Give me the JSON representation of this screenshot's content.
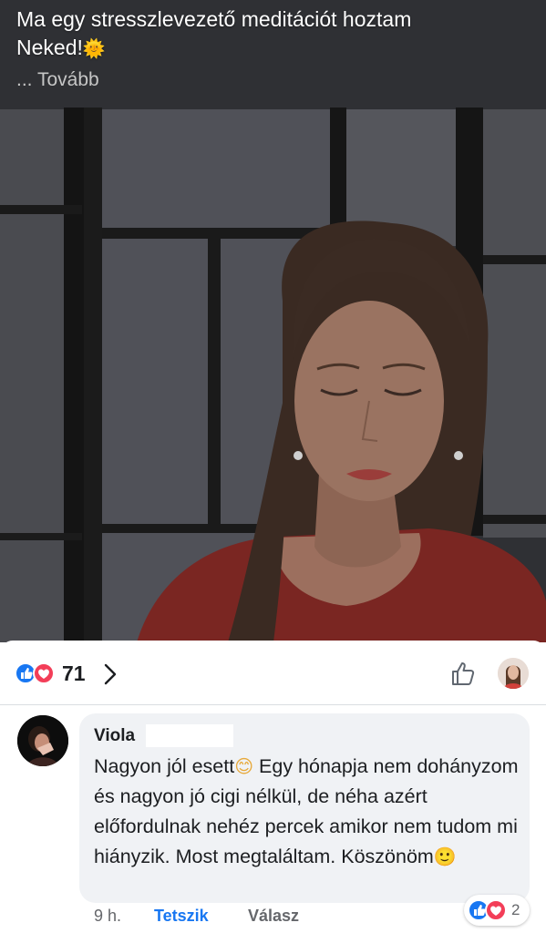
{
  "post": {
    "caption_line1": "Ma egy stresszlevezető meditációt hoztam",
    "caption_line2": "Neked!",
    "caption_emoji": "🌞",
    "more_label": "... Tovább"
  },
  "reactions": {
    "count": "71",
    "icons": [
      "like-icon",
      "love-icon"
    ]
  },
  "comment": {
    "author": "Viola",
    "text": "Nagyon jól esett",
    "emoji1": "😊",
    "text2": " Egy hónapja nem dohányzom és nagyon jó cigi nélkül, de néha azért előfordulnak nehéz percek amikor nem tudom mi hiányzik. Most megtaláltam. Köszönöm",
    "emoji2": "🙂",
    "time": "9 h.",
    "like_label": "Tetszik",
    "reply_label": "Válasz",
    "reaction_count": "2"
  },
  "colors": {
    "like_blue": "#1877f2",
    "love_red": "#f33e58",
    "bubble_bg": "#f0f2f5"
  }
}
